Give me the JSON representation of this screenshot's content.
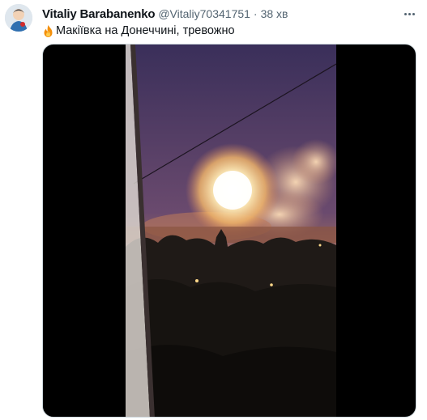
{
  "tweet": {
    "author_name": "Vitaliy Barabanenko",
    "handle": "@Vitaliy70341751",
    "separator": "·",
    "time": "38 хв",
    "text": "Макіївка на Донеччині, тревожно",
    "text_icon": "fire-emoji-icon"
  },
  "icons": {
    "more": "more-options-icon",
    "avatar": "avatar-image"
  },
  "colors": {
    "name": "#0f1419",
    "secondary": "#536471",
    "media_bg": "#000000",
    "explosion": "#fff3c4"
  }
}
